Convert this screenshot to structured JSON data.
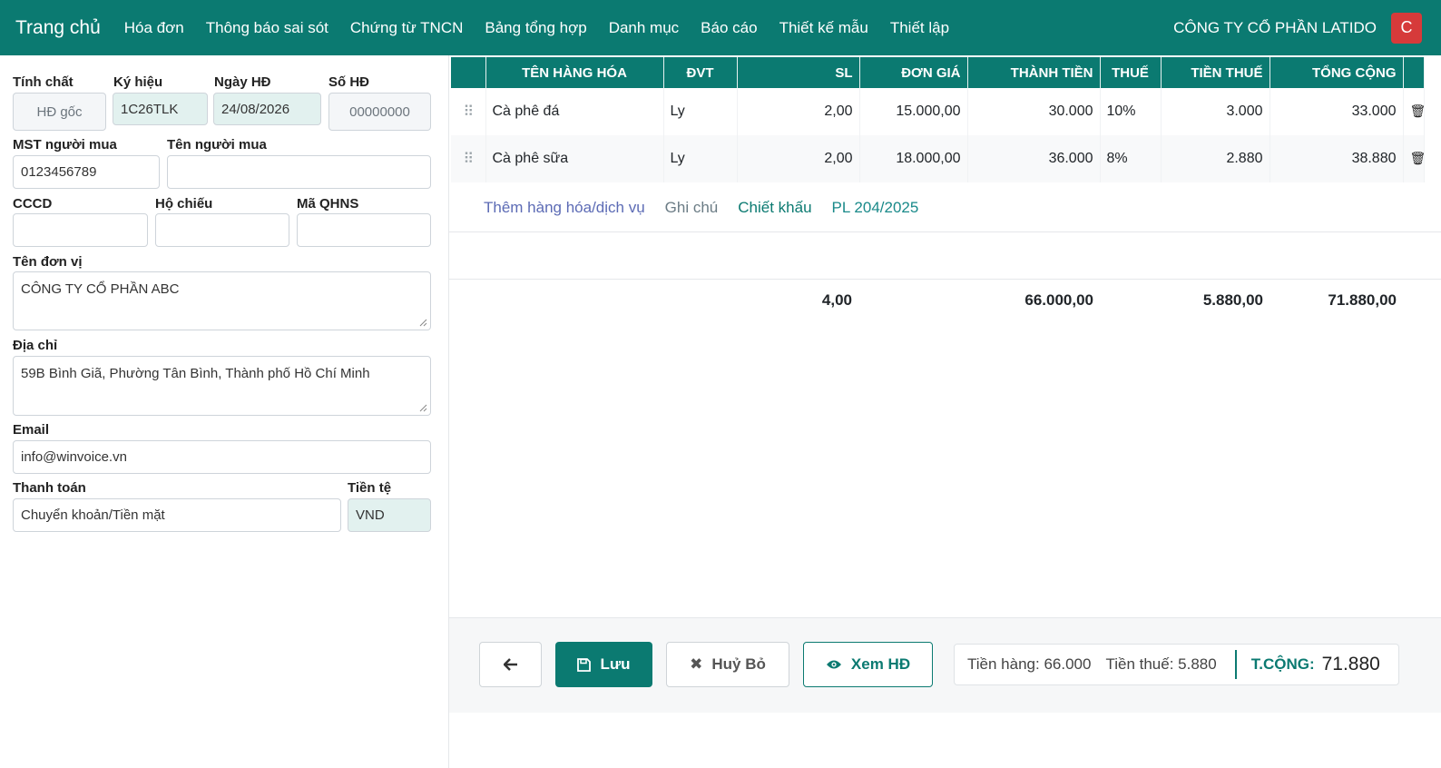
{
  "nav": {
    "brand": "Trang chủ",
    "items": [
      "Hóa đơn",
      "Thông báo sai sót",
      "Chứng từ TNCN",
      "Bảng tổng hợp",
      "Danh mục",
      "Báo cáo",
      "Thiết kế mẫu",
      "Thiết lập"
    ],
    "company": "CÔNG TY CỔ PHẦN LATIDO",
    "avatar": "C"
  },
  "form": {
    "tinh_chat": {
      "label": "Tính chất",
      "value": "HĐ gốc"
    },
    "ky_hieu": {
      "label": "Ký hiệu",
      "value": "1C26TLK"
    },
    "ngay_hd": {
      "label": "Ngày HĐ",
      "value": "24/08/2026"
    },
    "so_hd": {
      "label": "Số HĐ",
      "value": "00000000"
    },
    "mst": {
      "label": "MST người mua",
      "value": "0123456789"
    },
    "ten_nguoi_mua": {
      "label": "Tên người mua",
      "value": ""
    },
    "cccd": {
      "label": "CCCD",
      "value": ""
    },
    "ho_chieu": {
      "label": "Hộ chiếu",
      "value": ""
    },
    "ma_qhns": {
      "label": "Mã QHNS",
      "value": ""
    },
    "ten_don_vi": {
      "label": "Tên đơn vị",
      "value": "CÔNG TY CỔ PHẦN ABC"
    },
    "dia_chi": {
      "label": "Địa chỉ",
      "value": "59B Bình Giã, Phường Tân Bình, Thành phố Hồ Chí Minh"
    },
    "email": {
      "label": "Email",
      "value": "info@winvoice.vn"
    },
    "thanh_toan": {
      "label": "Thanh toán",
      "value": "Chuyển khoản/Tiền mặt"
    },
    "tien_te": {
      "label": "Tiền tệ",
      "value": "VND"
    }
  },
  "table": {
    "headers": [
      "TÊN HÀNG HÓA",
      "ĐVT",
      "SL",
      "ĐƠN GIÁ",
      "THÀNH TIỀN",
      "THUẾ",
      "TIỀN THUẾ",
      "TỔNG CỘNG"
    ],
    "rows": [
      {
        "name": "Cà phê đá",
        "unit": "Ly",
        "qty": "2,00",
        "price": "15.000,00",
        "amount": "30.000",
        "tax": "10%",
        "tax_amount": "3.000",
        "total": "33.000"
      },
      {
        "name": "Cà phê sữa",
        "unit": "Ly",
        "qty": "2,00",
        "price": "18.000,00",
        "amount": "36.000",
        "tax": "8%",
        "tax_amount": "2.880",
        "total": "38.880"
      }
    ],
    "links": {
      "add_item": "Thêm hàng hóa/dịch vụ",
      "note": "Ghi chú",
      "discount": "Chiết khấu",
      "appendix": "PL 204/2025"
    },
    "totals": {
      "qty": "4,00",
      "amount": "66.000,00",
      "tax_amount": "5.880,00",
      "total": "71.880,00"
    }
  },
  "footer": {
    "save_label": "Lưu",
    "cancel_label": "Huỷ Bỏ",
    "view_label": "Xem HĐ",
    "goods_label": "Tiền hàng:",
    "goods_value": "66.000",
    "tax_label": "Tiền thuế:",
    "tax_value": "5.880",
    "total_label": "T.CỘNG:",
    "total_value": "71.880"
  },
  "colors": {
    "primary": "#0b7a71",
    "avatar": "#d63a3a"
  }
}
